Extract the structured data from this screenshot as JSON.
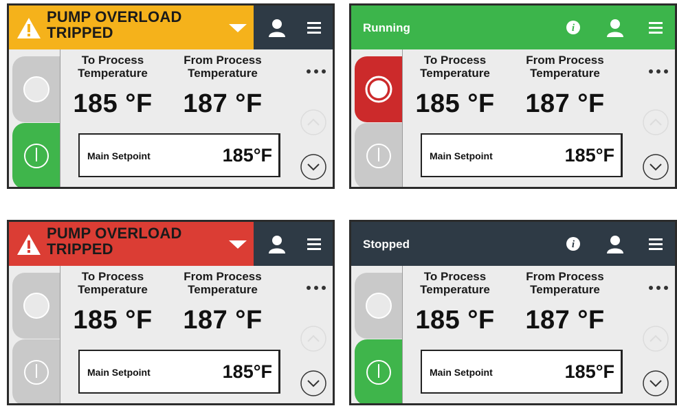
{
  "panels": {
    "p1": {
      "alarm_text_1": "PUMP OVERLOAD",
      "alarm_text_2": "TRIPPED"
    },
    "p2": {
      "status_text": "Running"
    },
    "p3": {
      "alarm_text_1": "PUMP OVERLOAD",
      "alarm_text_2": "TRIPPED"
    },
    "p4": {
      "status_text": "Stopped"
    }
  },
  "readings": {
    "to_process_label_1": "To Process",
    "to_process_label_2": "Temperature",
    "from_process_label_1": "From Process",
    "from_process_label_2": "Temperature",
    "to_process_value": "185 °F",
    "from_process_value": "187 °F"
  },
  "setpoint": {
    "label": "Main Setpoint",
    "value": "185°F"
  },
  "icons": {
    "warning": "warning-triangle-icon",
    "dropdown": "chevron-down-icon",
    "user": "user-icon",
    "menu": "hamburger-menu-icon",
    "info": "info-icon",
    "more": "ellipsis-icon",
    "stop": "stop-icon",
    "power": "power-icon",
    "scroll_up": "scroll-up-icon",
    "scroll_down": "scroll-down-icon"
  },
  "colors": {
    "alarm_yellow": "#f5b21b",
    "alarm_red": "#db3d34",
    "running_green": "#3cb54b",
    "header_dark": "#2e3a45",
    "stop_red": "#cc2a2b",
    "start_green": "#3fb54b",
    "inactive_gray": "#c9c9c9"
  }
}
